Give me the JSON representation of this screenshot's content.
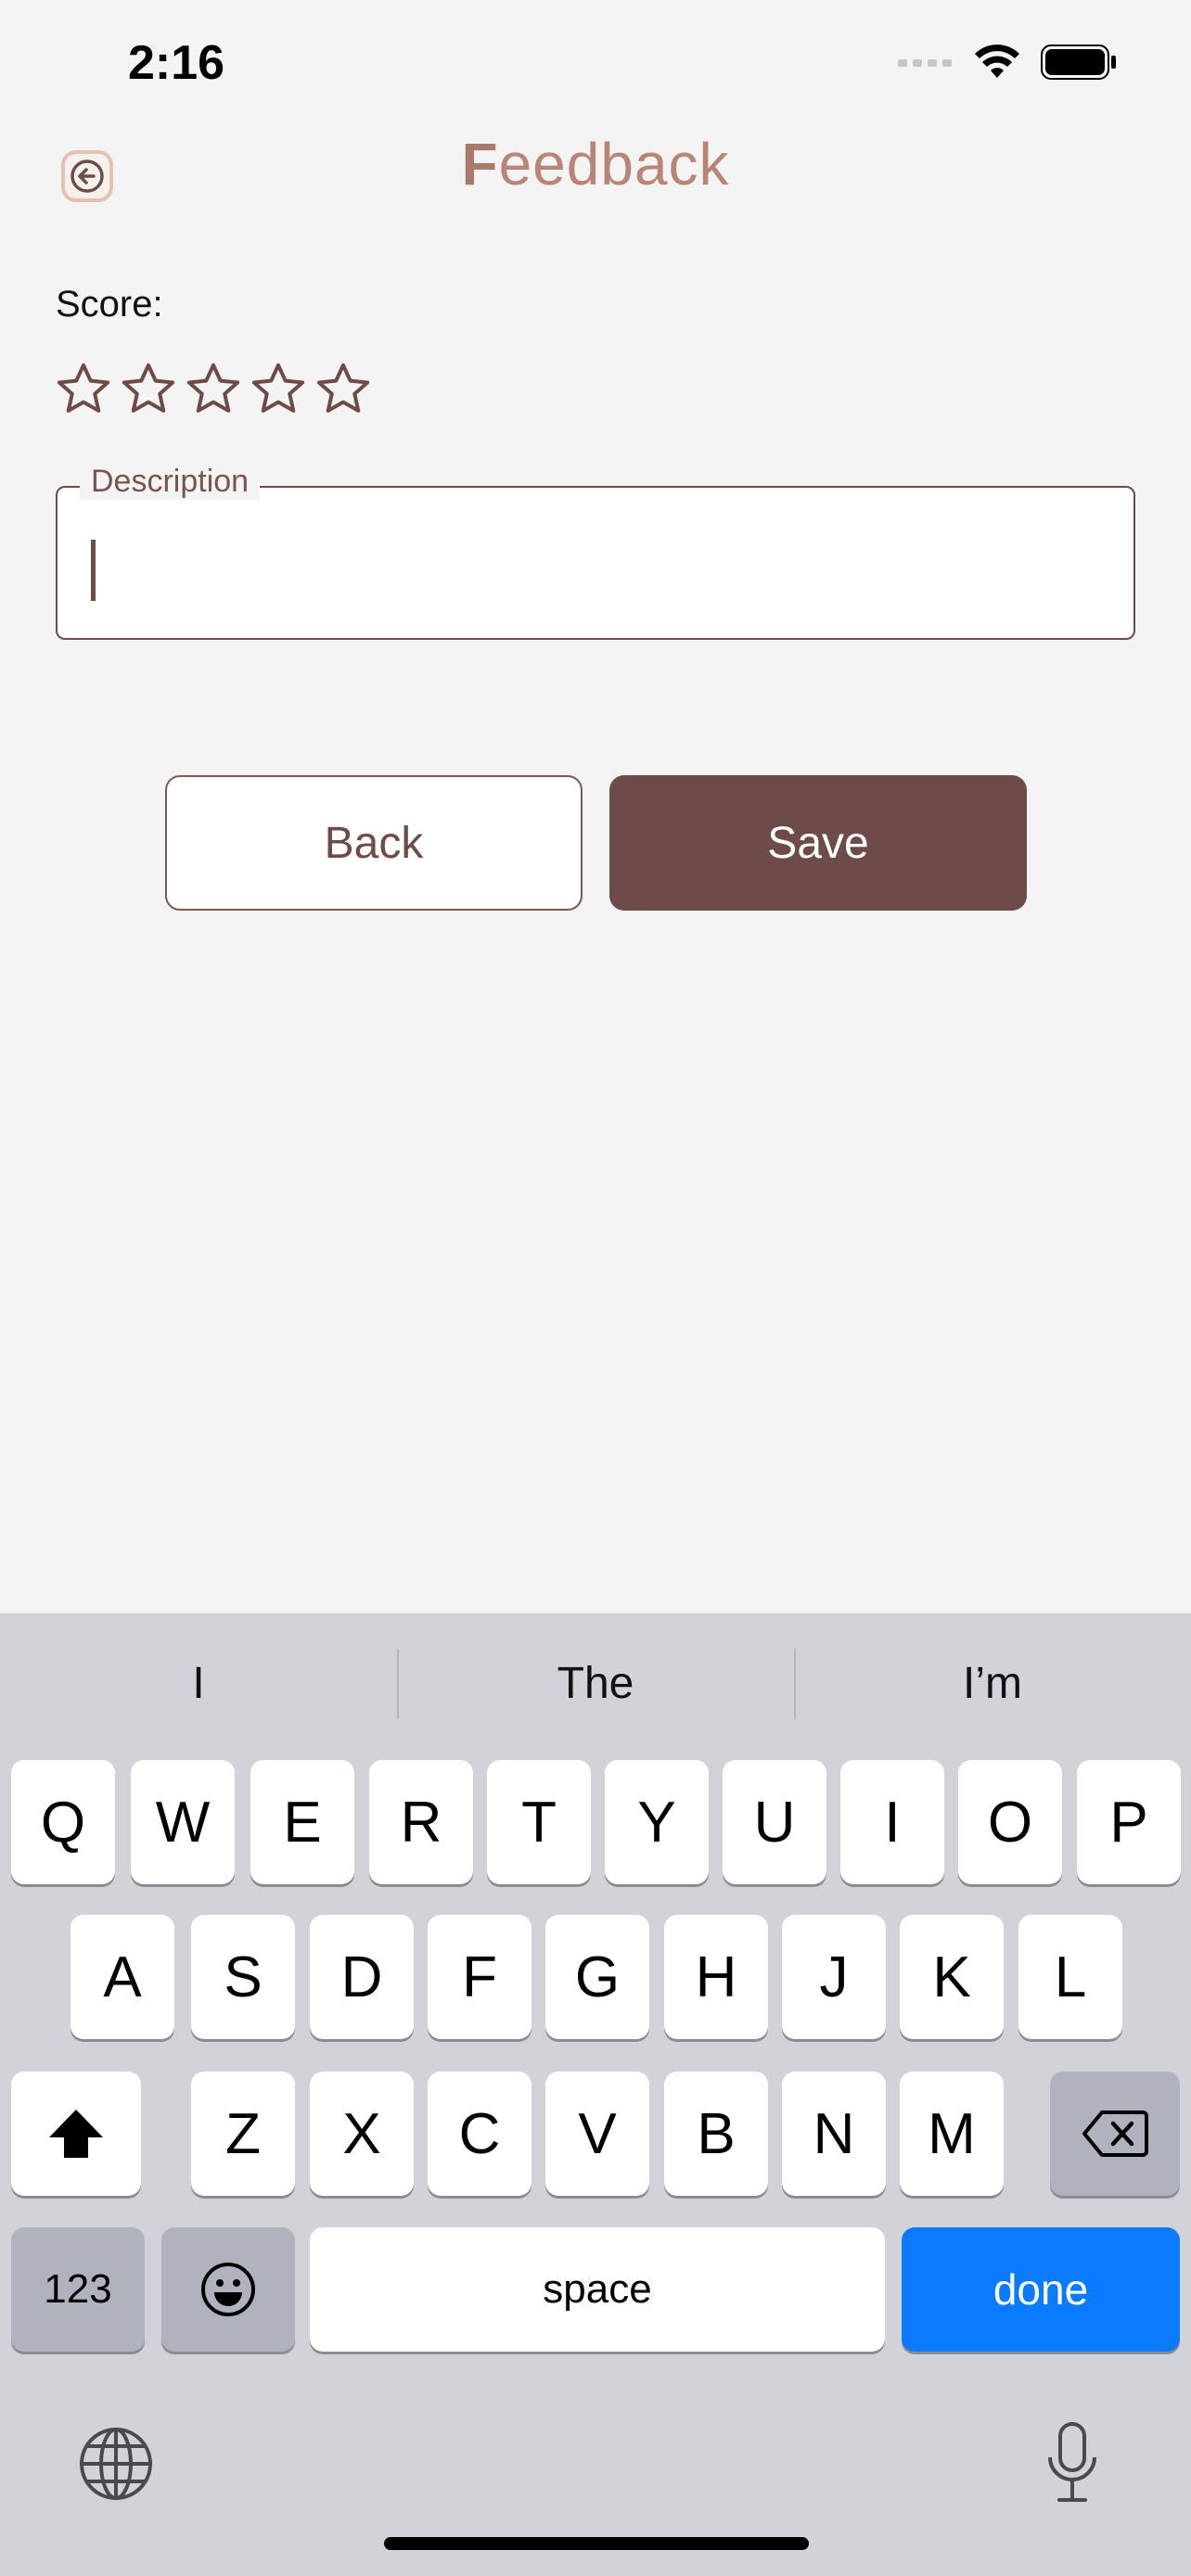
{
  "status_bar": {
    "time": "2:16"
  },
  "header": {
    "title_first": "F",
    "title_rest": "eedback"
  },
  "score": {
    "label": "Score:",
    "rating": 0,
    "max": 5
  },
  "description": {
    "label": "Description",
    "value": ""
  },
  "buttons": {
    "back": "Back",
    "save": "Save"
  },
  "keyboard": {
    "suggestions": [
      "I",
      "The",
      "I’m"
    ],
    "row1": [
      "Q",
      "W",
      "E",
      "R",
      "T",
      "Y",
      "U",
      "I",
      "O",
      "P"
    ],
    "row2": [
      "A",
      "S",
      "D",
      "F",
      "G",
      "H",
      "J",
      "K",
      "L"
    ],
    "row3": [
      "Z",
      "X",
      "C",
      "V",
      "B",
      "N",
      "M"
    ],
    "numbers_key": "123",
    "space_key": "space",
    "done_key": "done"
  },
  "colors": {
    "accent": "#6d4b48",
    "title": "#b98577",
    "done": "#0a7aff"
  }
}
